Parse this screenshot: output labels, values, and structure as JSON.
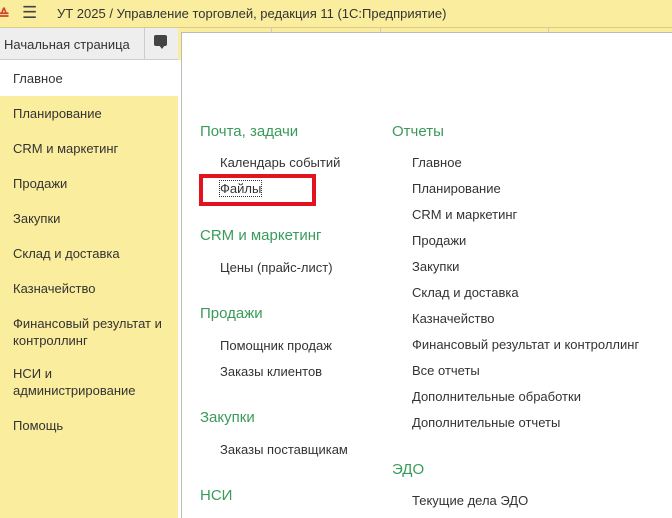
{
  "app": {
    "title": "УТ 2025 / Управление торговлей, редакция 11  (1С:Предприятие)",
    "home_tab": "Начальная страница"
  },
  "sidebar": {
    "items": [
      {
        "label": "Главное"
      },
      {
        "label": "Планирование"
      },
      {
        "label": "CRM и маркетинг"
      },
      {
        "label": "Продажи"
      },
      {
        "label": "Закупки"
      },
      {
        "label": "Склад и доставка"
      },
      {
        "label": "Казначейство"
      },
      {
        "label": "Финансовый результат и контроллинг"
      },
      {
        "label": "НСИ и администрирование"
      },
      {
        "label": "Помощь"
      }
    ]
  },
  "content": {
    "col1": [
      {
        "header": "Почта, задачи",
        "items": [
          "Календарь событий",
          "Файлы"
        ]
      },
      {
        "header": "CRM и маркетинг",
        "items": [
          "Цены (прайс-лист)"
        ]
      },
      {
        "header": "Продажи",
        "items": [
          "Помощник продаж",
          "Заказы клиентов"
        ]
      },
      {
        "header": "Закупки",
        "items": [
          "Заказы поставщикам"
        ]
      },
      {
        "header": "НСИ",
        "items": []
      }
    ],
    "col2": [
      {
        "header": "Отчеты",
        "items": [
          "Главное",
          "Планирование",
          "CRM и маркетинг",
          "Продажи",
          "Закупки",
          "Склад и доставка",
          "Казначейство",
          "Финансовый результат и контроллинг",
          "Все отчеты",
          "Дополнительные обработки",
          "Дополнительные отчеты"
        ]
      },
      {
        "header": "ЭДО",
        "items": [
          "Текущие дела ЭДО"
        ]
      }
    ]
  }
}
